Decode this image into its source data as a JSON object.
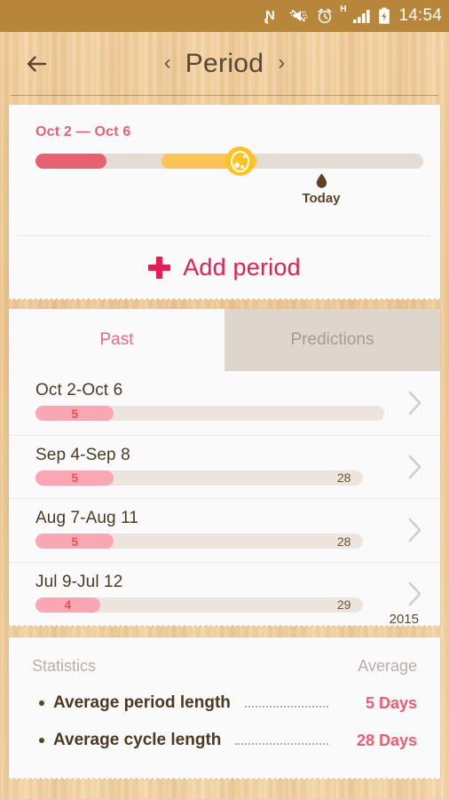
{
  "statusbar": {
    "time": "14:54",
    "network_type": "H",
    "icons": [
      "nfc-icon",
      "mute-vibrate-icon",
      "alarm-clock-icon",
      "signal-bars-icon",
      "battery-charging-icon"
    ]
  },
  "header": {
    "title": "Period",
    "back_icon": "back-arrow-icon",
    "prev_label": "‹",
    "next_label": "›"
  },
  "period_card": {
    "range_label": "Oct 2 — Oct 6",
    "today_label": "Today",
    "add_period_label": "Add period",
    "track": {
      "period_start_pct": 0,
      "period_width_pct": 18.3,
      "fertile_start_pct": 32.5,
      "fertile_width_pct": 24.7,
      "ovulation_marker_pct": 49.0,
      "today_marker_pct": 69.0
    },
    "colors": {
      "period": "#e96073",
      "fertile": "#fcc355",
      "ovulation": "#ffc41f",
      "track": "#e2dcd4",
      "accent": "#e31e52"
    }
  },
  "tabs": [
    {
      "label": "Past",
      "active": true
    },
    {
      "label": "Predictions",
      "active": false
    }
  ],
  "list": {
    "rows": [
      {
        "date": "Oct 2-Oct 6",
        "days": "5",
        "cycle": "",
        "bar_pct": 100,
        "seg_pct": 22.5,
        "year": ""
      },
      {
        "date": "Sep 4-Sep 8",
        "days": "5",
        "cycle": "28",
        "bar_pct": 94,
        "seg_pct": 22.5,
        "year": ""
      },
      {
        "date": "Aug 7-Aug 11",
        "days": "5",
        "cycle": "28",
        "bar_pct": 94,
        "seg_pct": 22.5,
        "year": ""
      },
      {
        "date": "Jul 9-Jul 12",
        "days": "4",
        "cycle": "29",
        "bar_pct": 94,
        "seg_pct": 18.5,
        "year": "2015"
      }
    ]
  },
  "statistics": {
    "title": "Statistics",
    "column_label": "Average",
    "items": [
      {
        "name": "Average period length",
        "value": "5 Days"
      },
      {
        "name": "Average cycle length",
        "value": "28 Days"
      }
    ]
  }
}
